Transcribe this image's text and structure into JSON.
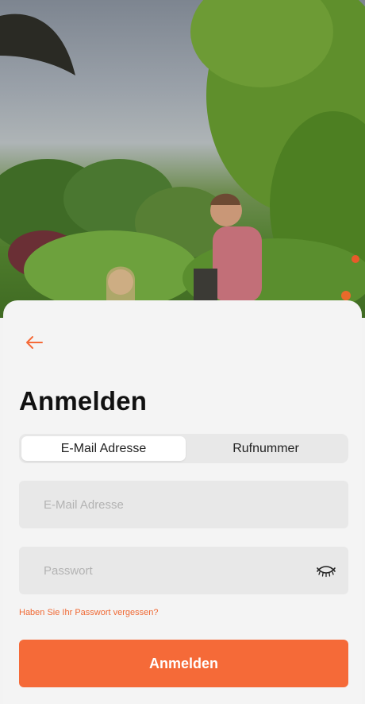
{
  "header": {
    "back_icon": "arrow-left-icon"
  },
  "title": "Anmelden",
  "tabs": [
    {
      "label": "E-Mail Adresse",
      "selected": true
    },
    {
      "label": "Rufnummer",
      "selected": false
    }
  ],
  "form": {
    "email": {
      "value": "",
      "placeholder": "E-Mail Adresse"
    },
    "password": {
      "value": "",
      "placeholder": "Passwort",
      "toggle_icon": "eye-closed-icon"
    },
    "forgot_label": "Haben Sie Ihr Passwort vergessen?",
    "submit_label": "Anmelden"
  },
  "colors": {
    "accent": "#f56a38",
    "sheet_background": "#f4f4f4",
    "field_background": "#e8e8e8"
  }
}
